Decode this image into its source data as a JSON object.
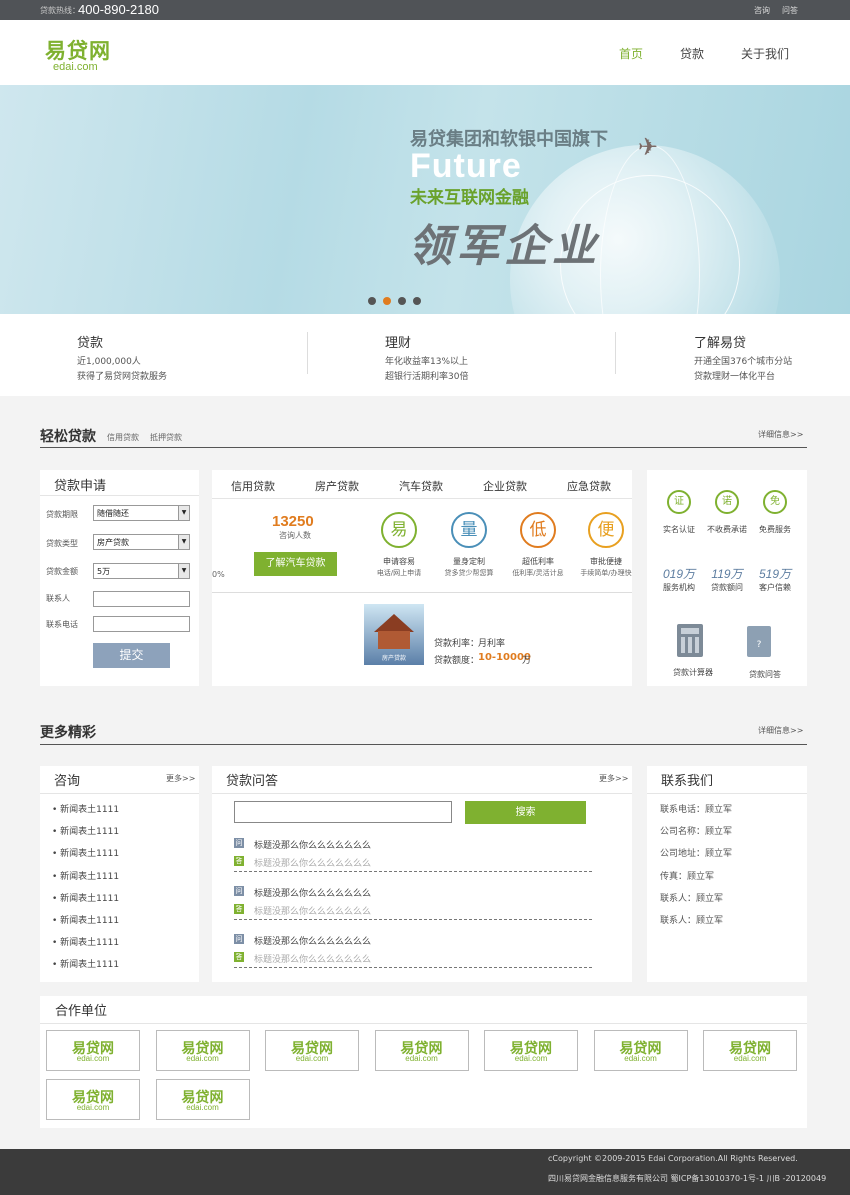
{
  "topbar": {
    "hotline_label": "贷款热线：",
    "hotline": "400-890-2180",
    "consult": "咨询",
    "ask": "问答"
  },
  "header": {
    "logo_cn": "易贷网",
    "logo_en": "edai.com",
    "nav": [
      "首页",
      "贷款",
      "关于我们"
    ],
    "active_nav": "首页"
  },
  "banner": {
    "headline": "易贷集团和软银中国旗下",
    "future": "Future",
    "sub": "未来互联网金融",
    "big": "领军企业",
    "slides": 4,
    "active_slide": 2
  },
  "features": [
    {
      "title": "贷款",
      "line1": "近1,000,000人",
      "line2": "获得了易贷网贷款服务"
    },
    {
      "title": "理财",
      "line1": "年化收益率13%以上",
      "line2": "超银行活期利率30倍"
    },
    {
      "title": "了解易贷",
      "line1": "开通全国376个城市分站",
      "line2": "贷款理财一体化平台"
    }
  ],
  "easy_loan": {
    "title": "轻松贷款",
    "tags": [
      "信用贷款",
      "抵押贷款"
    ],
    "more": "详细信息>>"
  },
  "apply": {
    "title": "贷款申请",
    "fields": [
      {
        "label": "贷款期限",
        "value": "随借随还"
      },
      {
        "label": "贷款类型",
        "value": "房产贷款"
      },
      {
        "label": "贷款金额",
        "value": "5万"
      }
    ],
    "contact_label": "联系人",
    "phone_label": "联系电话",
    "submit": "提交"
  },
  "loan_tabs": {
    "tabs": [
      "信用贷款",
      "房产贷款",
      "汽车贷款",
      "企业贷款",
      "应急贷款"
    ],
    "count": "13250",
    "count_label": "咨询人数",
    "cut_text": "0%",
    "learn_btn": "了解汽车贷款",
    "features": [
      {
        "icon": "易",
        "title": "申请容易",
        "sub": "电话/网上申请",
        "color": "#7fb130"
      },
      {
        "icon": "量",
        "title": "量身定制",
        "sub": "贷多贷少帮您算",
        "color": "#4a8fb8"
      },
      {
        "icon": "低",
        "title": "超低利率",
        "sub": "低利率/灵活计息",
        "color": "#e07c1f"
      },
      {
        "icon": "便",
        "title": "审批便捷",
        "sub": "手续简单/办理快",
        "color": "#e8a020"
      }
    ],
    "product_rate_label": "贷款利率：",
    "product_rate": "月利率",
    "product_amount_label": "贷款额度：",
    "product_amount": "10-10000",
    "product_amount_unit": "万",
    "product_img_text": "房产贷款"
  },
  "right_stats": {
    "icons": [
      {
        "glyph": "证",
        "label": "实名认证"
      },
      {
        "glyph": "诺",
        "label": "不收费承诺"
      },
      {
        "glyph": "免",
        "label": "免费服务"
      }
    ],
    "numbers": [
      {
        "value": "019万",
        "label": "服务机构"
      },
      {
        "value": "119万",
        "label": "贷款额问"
      },
      {
        "value": "519万",
        "label": "客户信赖"
      }
    ],
    "tools": [
      "贷款计算器",
      "贷款问答"
    ]
  },
  "more_section": {
    "title": "更多精彩",
    "more": "详细信息>>"
  },
  "news": {
    "title": "咨询",
    "more": "更多>>",
    "items": [
      "新闻表土1111",
      "新闻表土1111",
      "新闻表土1111",
      "新闻表土1111",
      "新闻表土1111",
      "新闻表土1111",
      "新闻表土1111",
      "新闻表土1111"
    ]
  },
  "qa": {
    "title": "贷款问答",
    "more": "更多>>",
    "search_placeholder": "",
    "search_btn": "搜索",
    "q_icon": "问",
    "a_icon": "答",
    "items": [
      {
        "q": "标题没那么你么么么么么么么",
        "a": "标题没那么你么么么么么么么"
      },
      {
        "q": "标题没那么你么么么么么么么",
        "a": "标题没那么你么么么么么么么"
      },
      {
        "q": "标题没那么你么么么么么么么",
        "a": "标题没那么你么么么么么么么"
      }
    ]
  },
  "contact": {
    "title": "联系我们",
    "items": [
      "联系电话：顾立军",
      "公司名称：顾立军",
      "公司地址：顾立军",
      "传真：顾立军",
      "联系人：顾立军",
      "联系人：顾立军"
    ]
  },
  "partners": {
    "title": "合作单位",
    "logo_cn": "易贷网",
    "logo_en": "edai.com",
    "count": 9
  },
  "footer": {
    "copyright": "cCopyright ©2009-2015 Edai Corporation.All Rights Reserved.",
    "icp": "四川易贷网金融信息服务有限公司 蜀ICP备13010370-1号-1 川B -20120049"
  }
}
